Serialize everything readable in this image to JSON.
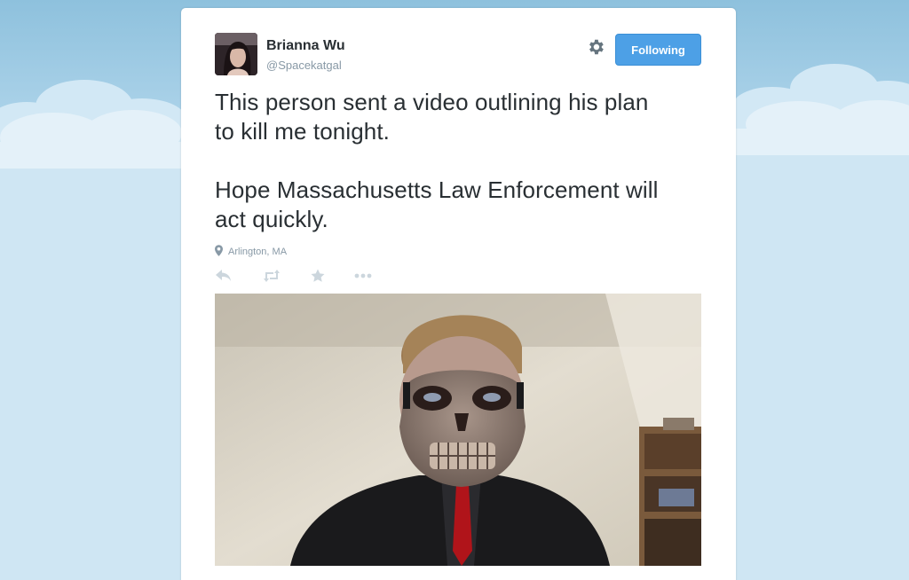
{
  "tweet": {
    "author_name": "Brianna Wu",
    "author_handle": "@Spacekatgal",
    "follow_label": "Following",
    "text": "This person sent a video outlining his plan\nto kill me tonight.\n\nHope Massachusetts Law Enforcement will\nact quickly.",
    "location": "Arlington, MA"
  },
  "icons": {
    "settings": "gear-icon",
    "location": "location-pin-icon",
    "reply": "reply-icon",
    "retweet": "retweet-icon",
    "favorite": "star-icon",
    "more": "more-icon"
  },
  "colors": {
    "follow_button": "#4da0e6",
    "text": "#292f33",
    "muted": "#8899a6",
    "action_icons": "#ccd6dd",
    "sky": "#a9d1e8"
  }
}
